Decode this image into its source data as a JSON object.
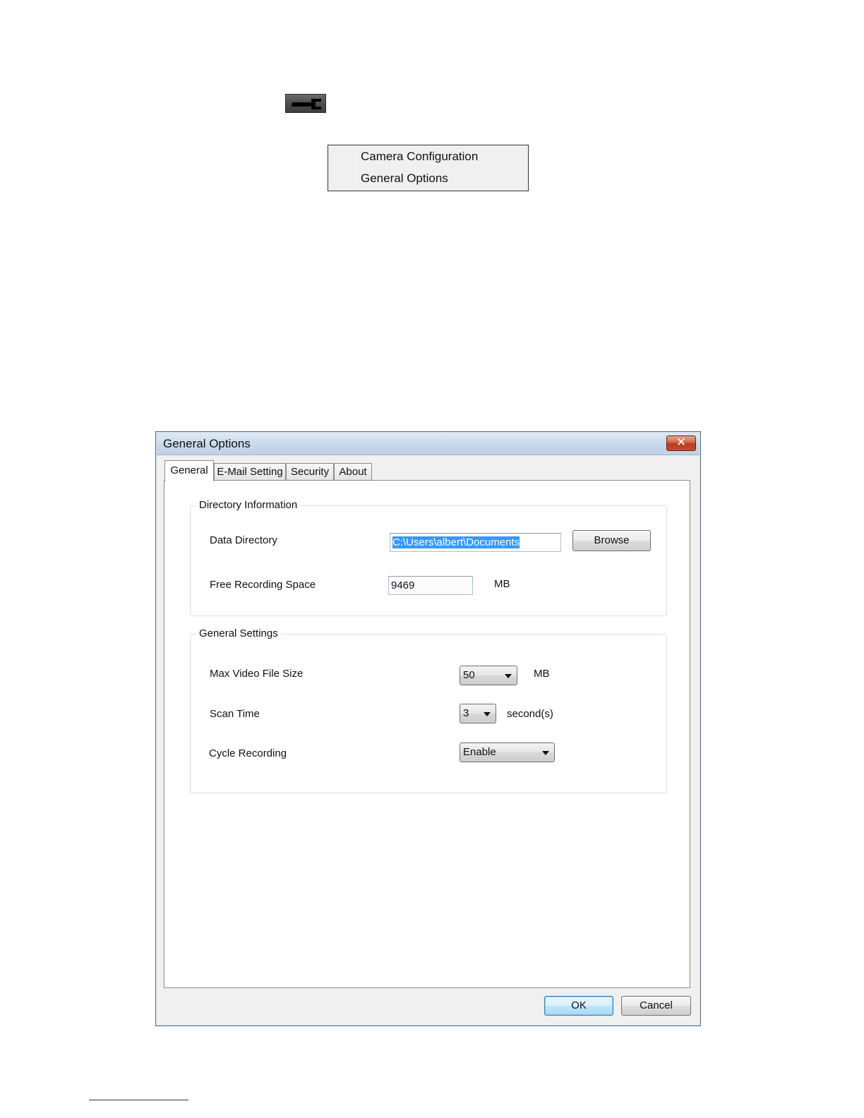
{
  "context_menu": {
    "items": [
      "Camera Configuration",
      "General Options"
    ]
  },
  "dialog": {
    "title": "General Options",
    "close_glyph": "✕",
    "tabs": [
      "General",
      "E-Mail Setting",
      "Security",
      "About"
    ],
    "active_tab": "General",
    "directory_group": {
      "title": "Directory Information",
      "data_directory_label": "Data Directory",
      "data_directory_value": "C:\\Users\\albert\\Documents",
      "browse_label": "Browse",
      "free_space_label": "Free Recording Space",
      "free_space_value": "9469",
      "free_space_unit": "MB"
    },
    "settings_group": {
      "title": "General Settings",
      "max_file_size_label": "Max Video File Size",
      "max_file_size_value": "50",
      "max_file_size_unit": "MB",
      "scan_time_label": "Scan Time",
      "scan_time_value": "3",
      "scan_time_unit": "second(s)",
      "cycle_recording_label": "Cycle Recording",
      "cycle_recording_value": "Enable"
    },
    "ok_label": "OK",
    "cancel_label": "Cancel"
  },
  "icons": {
    "toolbar_button": "wrench-icon",
    "close_button": "close-icon",
    "dropdown": "chevron-down-icon"
  },
  "colors": {
    "selection": "#3399ff",
    "close_button": "#c84a2c",
    "titlebar": "#c7d7ea"
  }
}
